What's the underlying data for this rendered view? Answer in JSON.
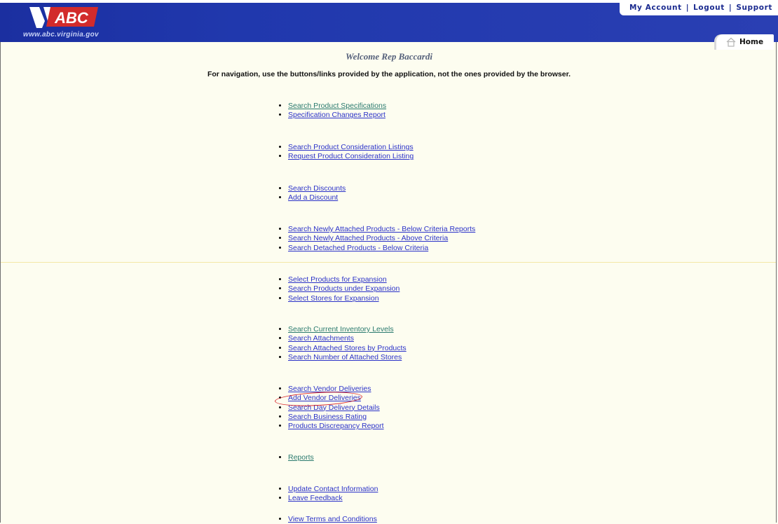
{
  "header": {
    "logo_text": "ABC",
    "site_url": "www.abc.virginia.gov",
    "nav": {
      "my_account": "My Account",
      "logout": "Logout",
      "support": "Support",
      "separator": "|"
    },
    "home_tab": "Home"
  },
  "main": {
    "welcome": "Welcome Rep Baccardi",
    "notice": "For navigation, use the buttons/links provided by the application, not the ones provided by the browser.",
    "groups": [
      {
        "items": [
          {
            "label": "Search Product Specifications"
          },
          {
            "label": "Specification Changes Report"
          }
        ]
      },
      {
        "items": [
          {
            "label": "Search Product Consideration Listings"
          },
          {
            "label": "Request Product Consideration Listing"
          }
        ]
      },
      {
        "items": [
          {
            "label": "Search Discounts"
          },
          {
            "label": "Add a Discount"
          }
        ]
      },
      {
        "items": [
          {
            "label": "Search Newly Attached Products - Below Criteria Reports"
          },
          {
            "label": "Search Newly Attached Products - Above Criteria"
          },
          {
            "label": "Search Detached Products - Below Criteria"
          }
        ]
      },
      {
        "items": [
          {
            "label": "Select Products for Expansion"
          },
          {
            "label": "Search Products under Expansion"
          },
          {
            "label": "Select Stores for Expansion"
          }
        ]
      },
      {
        "items": [
          {
            "label": "Search Current Inventory Levels"
          },
          {
            "label": "Search Attachments"
          },
          {
            "label": "Search Attached Stores by Products"
          },
          {
            "label": "Search Number of Attached Stores"
          }
        ]
      },
      {
        "items": [
          {
            "label": "Search Vendor Deliveries"
          },
          {
            "label": "Add Vendor Deliveries"
          },
          {
            "label": "Search Day Delivery Details"
          },
          {
            "label": "Search Business Rating"
          },
          {
            "label": "Products Discrepancy Report"
          }
        ]
      },
      {
        "items": [
          {
            "label": "Reports"
          }
        ]
      },
      {
        "items": [
          {
            "label": "Update Contact Information"
          },
          {
            "label": "Leave Feedback"
          }
        ]
      },
      {
        "items": [
          {
            "label": "View Terms and Conditions"
          }
        ]
      }
    ]
  },
  "colors": {
    "header_blue": "#2038ad",
    "link_blue": "#2b32c8",
    "visited_link": "#2a7a6e",
    "page_bg": "#fdfdf0",
    "annotation_red": "#d9262b"
  },
  "icons": {
    "home": "home-icon",
    "logo": "abc-logo"
  }
}
